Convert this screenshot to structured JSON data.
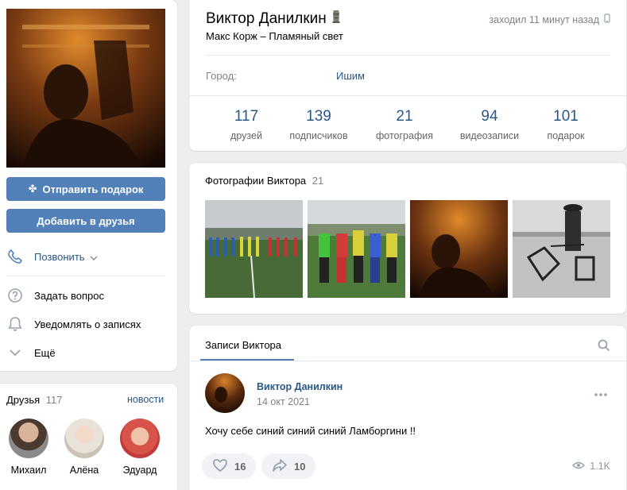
{
  "profile": {
    "name": "Виктор Данилкин",
    "status": "Макс Корж – Пламяный свет",
    "last_seen": "заходил 11 минут назад",
    "city_label": "Город:",
    "city_value": "Ишим",
    "counters": [
      {
        "value": "117",
        "label": "друзей"
      },
      {
        "value": "139",
        "label": "подписчиков"
      },
      {
        "value": "21",
        "label": "фотография"
      },
      {
        "value": "94",
        "label": "видеозаписи"
      },
      {
        "value": "101",
        "label": "подарок"
      }
    ]
  },
  "actions": {
    "gift_label": "Отправить подарок",
    "add_friend_label": "Добавить в друзья",
    "call_label": "Позвонить",
    "ask_label": "Задать вопрос",
    "notify_label": "Уведомлять о записях",
    "more_label": "Ещё"
  },
  "photos": {
    "title": "Фотографии Виктора",
    "count": "21"
  },
  "friends": {
    "title": "Друзья",
    "count": "117",
    "news_link": "новости",
    "list": [
      {
        "name": "Михаил"
      },
      {
        "name": "Алёна"
      },
      {
        "name": "Эдуард"
      }
    ]
  },
  "wall": {
    "tab_label": "Записи Виктора",
    "post": {
      "author": "Виктор Данилкин",
      "date": "14 окт 2021",
      "text": "Хочу себе синий синий синий Ламборгини !!",
      "likes": "16",
      "shares": "10",
      "views": "1.1K"
    }
  },
  "colors": {
    "accent": "#5181b8",
    "link": "#2a5885",
    "background": "#edeef0"
  }
}
